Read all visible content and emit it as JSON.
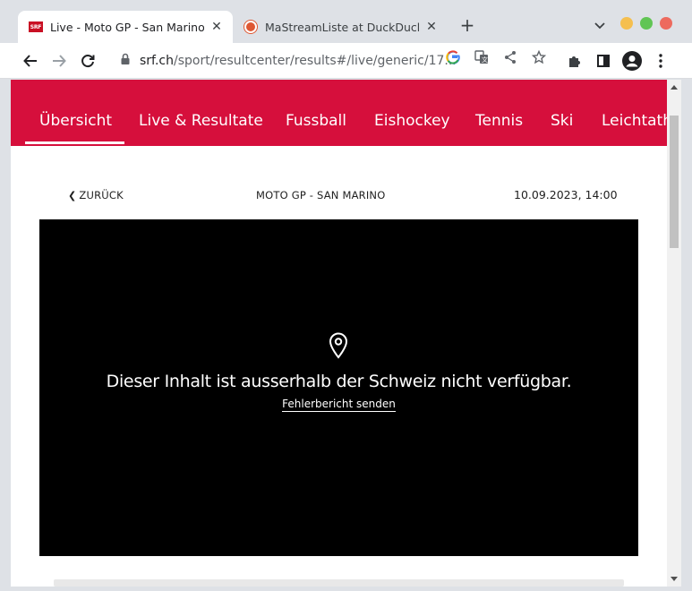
{
  "browser": {
    "tabs": [
      {
        "title": "Live - Moto GP - San Marino - ",
        "favicon": "srf-favicon",
        "favicon_text": "SRF",
        "active": true
      },
      {
        "title": "MaStreamListe at DuckDuckGo",
        "favicon": "duckduckgo-favicon",
        "active": false
      }
    ],
    "new_tab_label": "+",
    "close_label": "✕",
    "window_controls": {
      "minimize": "#f5bf4f",
      "maximize": "#61c554",
      "close": "#ed6a5e"
    },
    "url": {
      "host": "srf.ch",
      "path": "/sport/resultcenter/results#/live/generic/17..."
    }
  },
  "site": {
    "brand_color": "#d60f3c",
    "nav": [
      "Übersicht",
      "Live & Resultate",
      "Fussball",
      "Eishockey",
      "Tennis",
      "Ski",
      "Leichtathletik"
    ],
    "active_nav": "Übersicht"
  },
  "event_header": {
    "back_label": "ZURÜCK",
    "event_title": "MOTO GP - SAN MARINO",
    "datetime": "10.09.2023, 14:00"
  },
  "player": {
    "icon": "location-pin-icon",
    "message": "Dieser Inhalt ist ausserhalb der Schweiz nicht verfügbar.",
    "report_link": "Fehlerbericht senden"
  }
}
